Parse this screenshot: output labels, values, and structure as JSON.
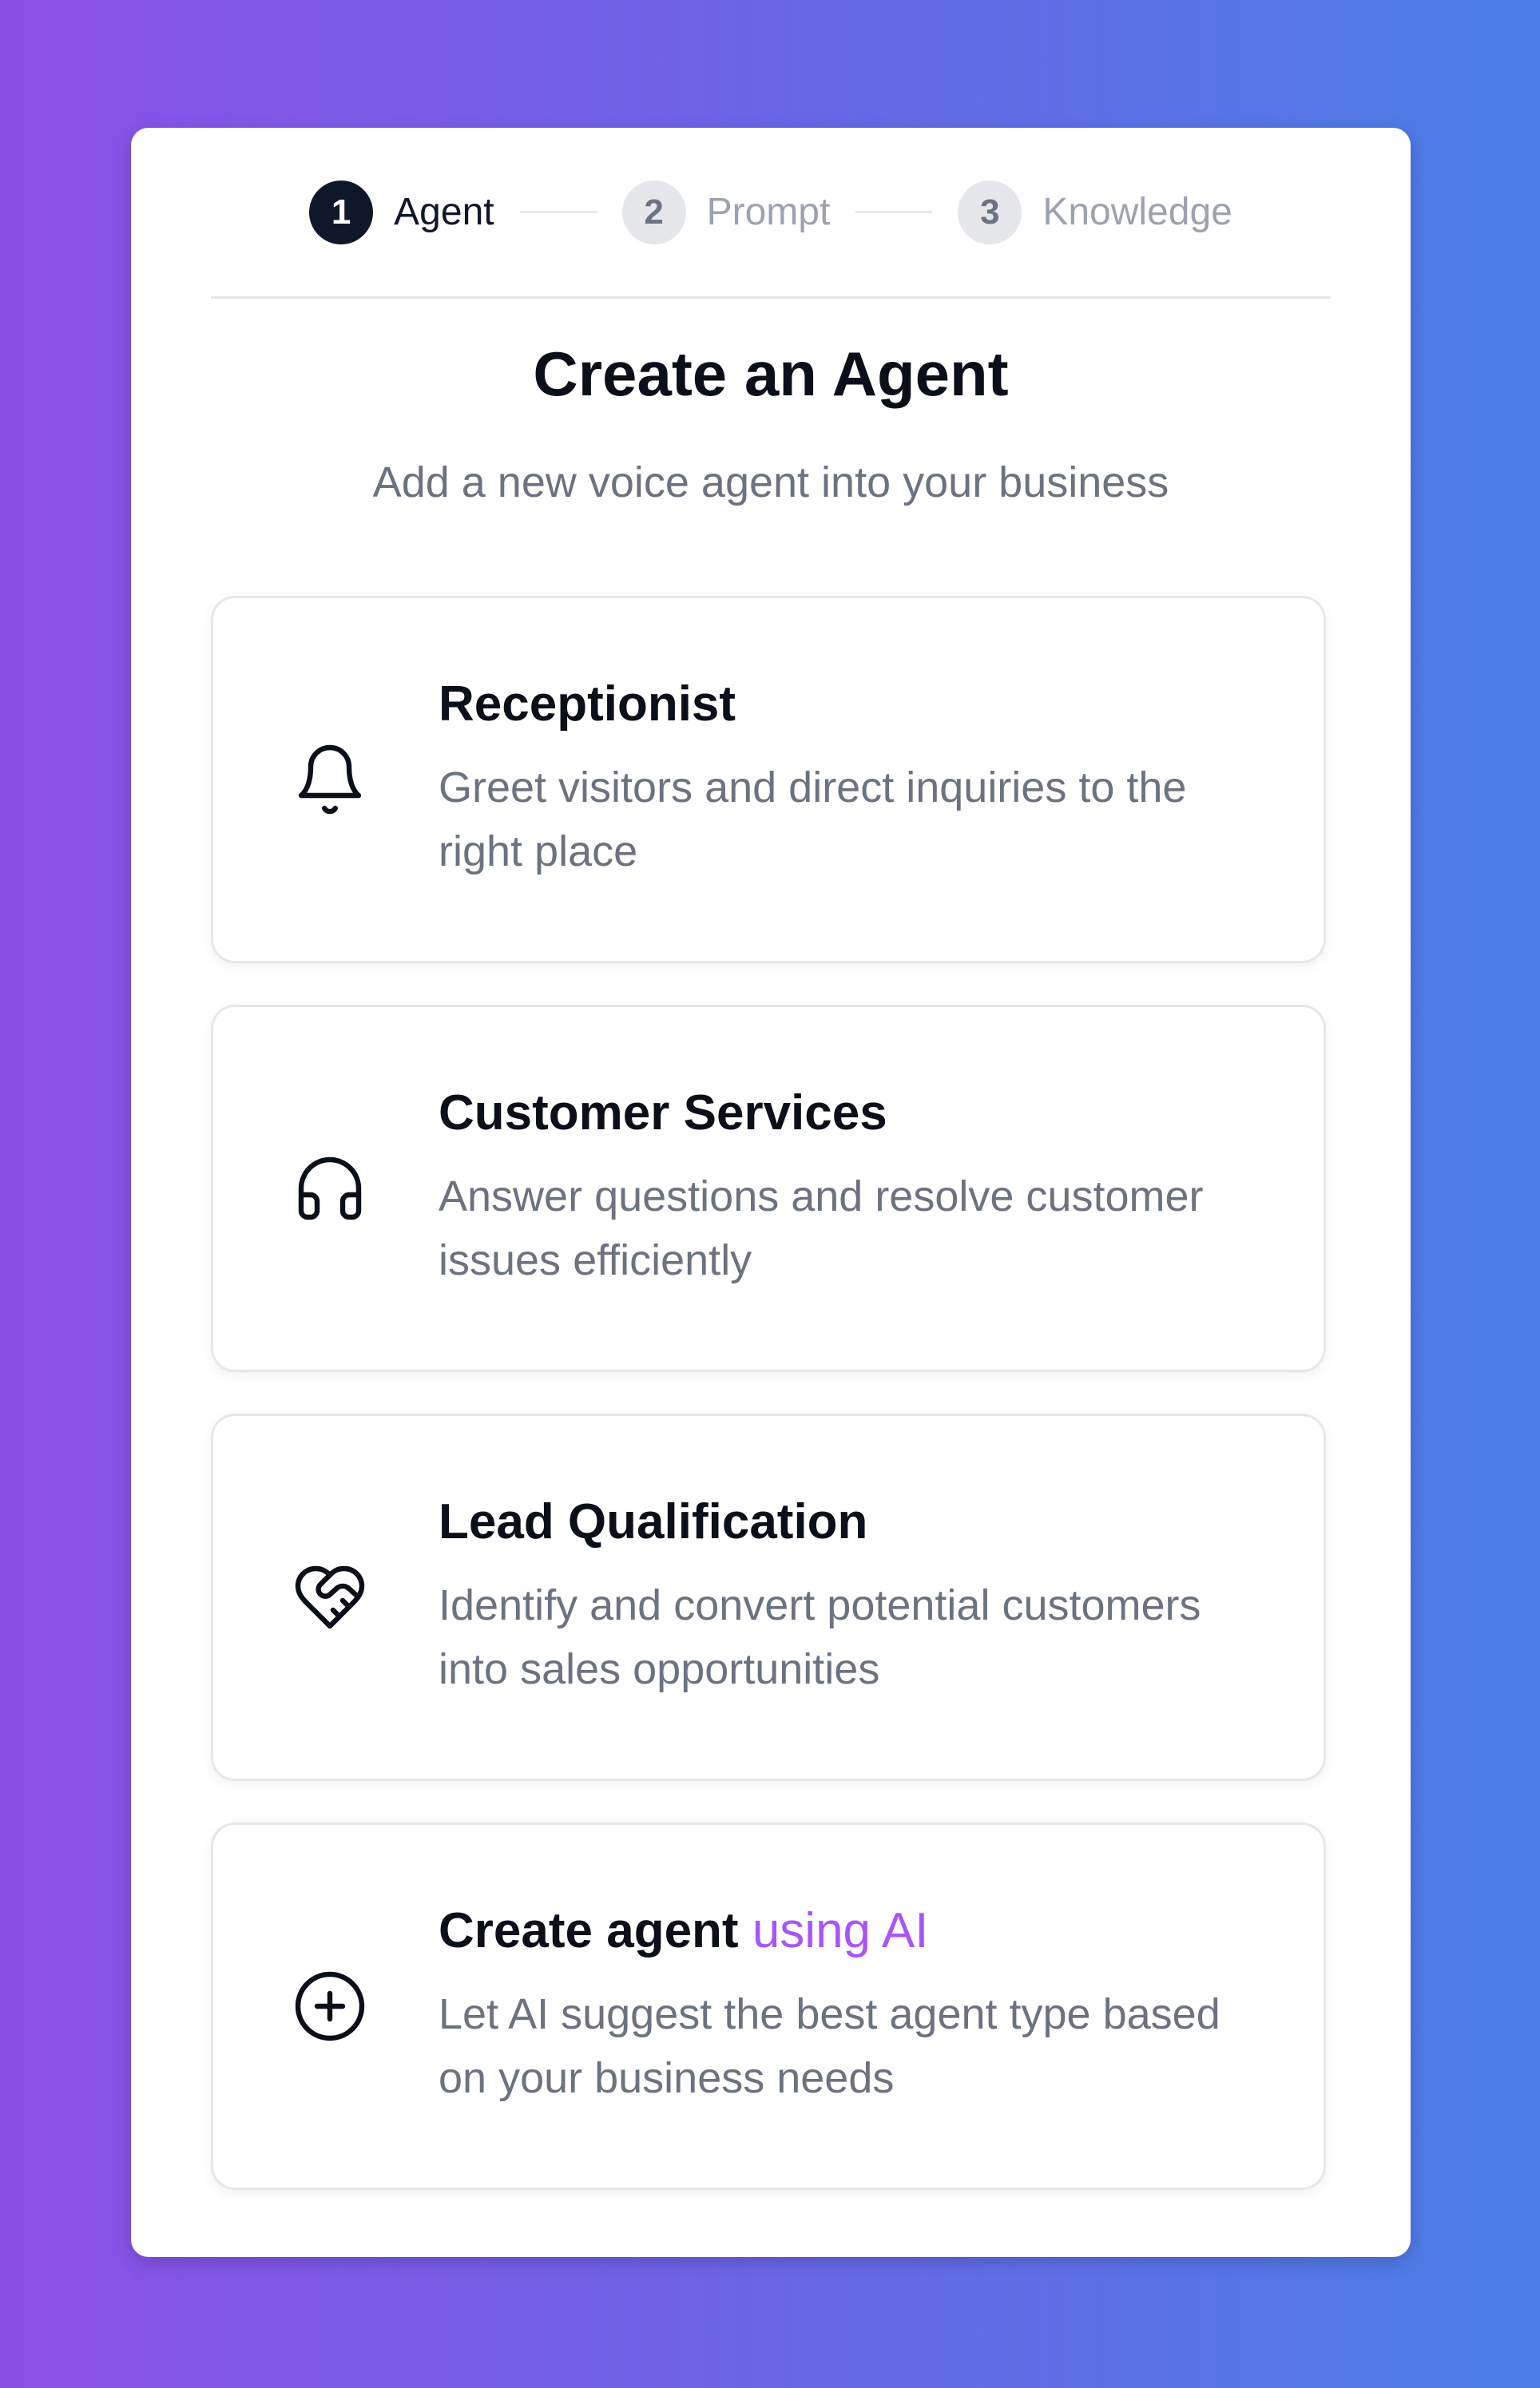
{
  "stepper": {
    "steps": [
      {
        "number": "1",
        "label": "Agent",
        "state": "active"
      },
      {
        "number": "2",
        "label": "Prompt",
        "state": "inactive"
      },
      {
        "number": "3",
        "label": "Knowledge",
        "state": "inactive"
      }
    ]
  },
  "header": {
    "title": "Create an Agent",
    "subtitle": "Add a new voice agent into your business"
  },
  "options": [
    {
      "icon": "bell-icon",
      "title": "Receptionist",
      "description": "Greet visitors and direct inquiries to the right place"
    },
    {
      "icon": "headphones-icon",
      "title": "Customer Services",
      "description": "Answer questions and resolve customer issues efficiently"
    },
    {
      "icon": "heart-handshake-icon",
      "title": "Lead Qualification",
      "description": "Identify and convert potential customers into sales opportunities"
    },
    {
      "icon": "plus-circle-icon",
      "title": "Create agent",
      "title_accent": "using AI",
      "description": "Let AI suggest the best agent type based on your business needs"
    }
  ],
  "colors": {
    "accent": "#a855f7",
    "active_step": "#0f172a",
    "muted_text": "#6b7280",
    "background_gradient_start": "#8b50e6",
    "background_gradient_end": "#4a7ee6"
  }
}
